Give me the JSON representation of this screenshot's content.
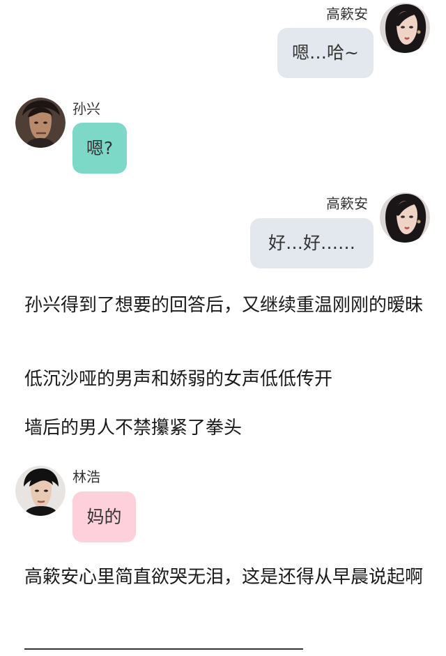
{
  "messages": [
    {
      "speaker": "高簌安",
      "text": "嗯…哈~",
      "bubble_color": "#e3e8ef",
      "avatar": "woman-avatar"
    },
    {
      "speaker": "孙兴",
      "text": "嗯?",
      "bubble_color": "#7dd8c8",
      "avatar": "man-avatar"
    },
    {
      "speaker": "高簌安",
      "text": "好…好……",
      "bubble_color": "#e3e8ef",
      "avatar": "woman-avatar"
    },
    {
      "speaker": "林浩",
      "text": "妈的",
      "bubble_color": "#fdd0db",
      "avatar": "man-avatar"
    }
  ],
  "narration": [
    "孙兴得到了想要的回答后，又继续重温刚刚的暧昧",
    "低沉沙哑的男声和娇弱的女声低低传开",
    "墙后的男人不禁攥紧了拳头",
    "高簌安心里简直欲哭无泪，这是还得从早晨说起啊"
  ]
}
